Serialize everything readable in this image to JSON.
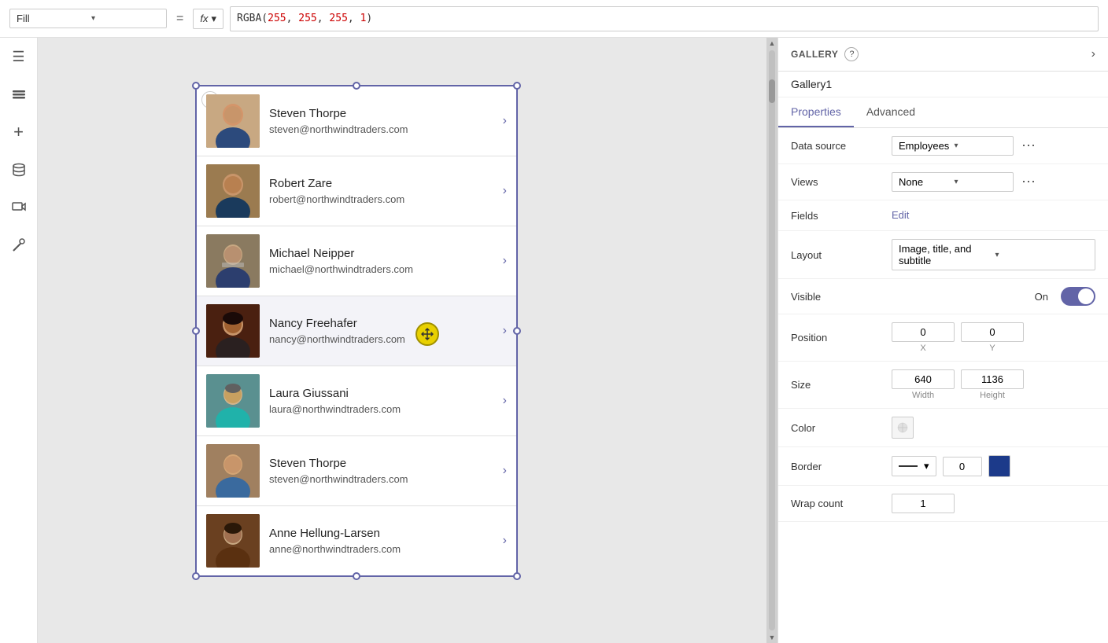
{
  "topbar": {
    "fill_label": "Fill",
    "equals": "=",
    "fx_label": "fx",
    "fx_chevron": "▾",
    "formula": "RGBA(255, 255, 255, 1)",
    "formula_prefix": "RGBA(",
    "formula_numbers": "255, 255, 255, 1",
    "formula_suffix": ")"
  },
  "sidebar": {
    "icons": [
      {
        "name": "hamburger-icon",
        "symbol": "☰"
      },
      {
        "name": "layers-icon",
        "symbol": "⊞"
      },
      {
        "name": "add-icon",
        "symbol": "+"
      },
      {
        "name": "data-icon",
        "symbol": "⬡"
      },
      {
        "name": "media-icon",
        "symbol": "▶"
      },
      {
        "name": "tools-icon",
        "symbol": "⚙"
      }
    ]
  },
  "gallery": {
    "items": [
      {
        "name": "Steven Thorpe",
        "email": "steven@northwindtraders.com",
        "avatar_class": "avatar-steven"
      },
      {
        "name": "Robert Zare",
        "email": "robert@northwindtraders.com",
        "avatar_class": "avatar-robert"
      },
      {
        "name": "Michael Neipper",
        "email": "michael@northwindtraders.com",
        "avatar_class": "avatar-michael"
      },
      {
        "name": "Nancy Freehafer",
        "email": "nancy@northwindtraders.com",
        "avatar_class": "avatar-nancy",
        "selected": true
      },
      {
        "name": "Laura Giussani",
        "email": "laura@northwindtraders.com",
        "avatar_class": "avatar-laura"
      },
      {
        "name": "Steven Thorpe",
        "email": "steven@northwindtraders.com",
        "avatar_class": "avatar-steven2"
      },
      {
        "name": "Anne Hellung-Larsen",
        "email": "anne@northwindtraders.com",
        "avatar_class": "avatar-anne"
      }
    ]
  },
  "right_panel": {
    "section_title": "GALLERY",
    "help_label": "?",
    "expand_label": "›",
    "gallery_name": "Gallery1",
    "tab_properties": "Properties",
    "tab_advanced": "Advanced",
    "props": {
      "data_source_label": "Data source",
      "data_source_value": "Employees",
      "views_label": "Views",
      "views_value": "None",
      "fields_label": "Fields",
      "fields_edit": "Edit",
      "layout_label": "Layout",
      "layout_value": "Image, title, and subtitle",
      "visible_label": "Visible",
      "visible_toggle": "On",
      "position_label": "Position",
      "pos_x": "0",
      "pos_y": "0",
      "pos_x_label": "X",
      "pos_y_label": "Y",
      "size_label": "Size",
      "size_width": "640",
      "size_height": "1136",
      "size_w_label": "Width",
      "size_h_label": "Height",
      "color_label": "Color",
      "border_label": "Border",
      "border_width": "0",
      "wrap_count_label": "Wrap count",
      "wrap_count_value": "1"
    }
  }
}
